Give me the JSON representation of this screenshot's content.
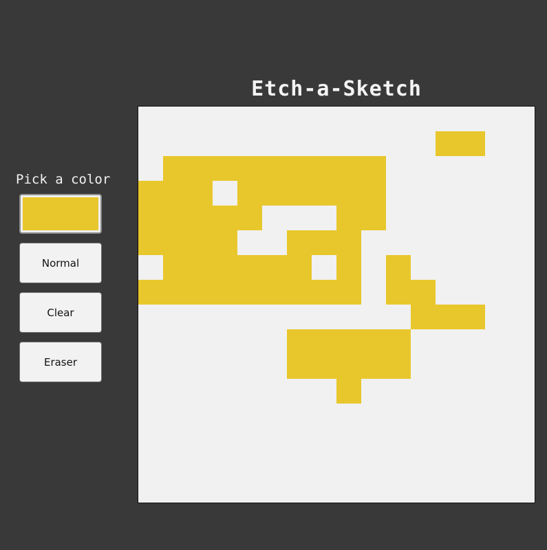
{
  "app": {
    "title": "Etch-a-Sketch"
  },
  "sidebar": {
    "pick_label": "Pick a color",
    "selected_color": "#e8c72c",
    "buttons": [
      {
        "label": "Normal"
      },
      {
        "label": "Clear"
      },
      {
        "label": "Eraser"
      }
    ]
  },
  "colors": {
    "background": "#393939",
    "board": "#f1f1f1",
    "paint": "#e8c72c"
  },
  "board": {
    "grid_size": 16,
    "painted_rows": [
      "................",
      "............##..",
      ".#########......",
      "###.######......",
      "#####...##......",
      "####..###.......",
      ".######.#.#.....",
      "#########.##....",
      "...........###..",
      "......#####.....",
      "......#####.....",
      "........#.......",
      "................",
      "................",
      "................",
      "................"
    ]
  }
}
